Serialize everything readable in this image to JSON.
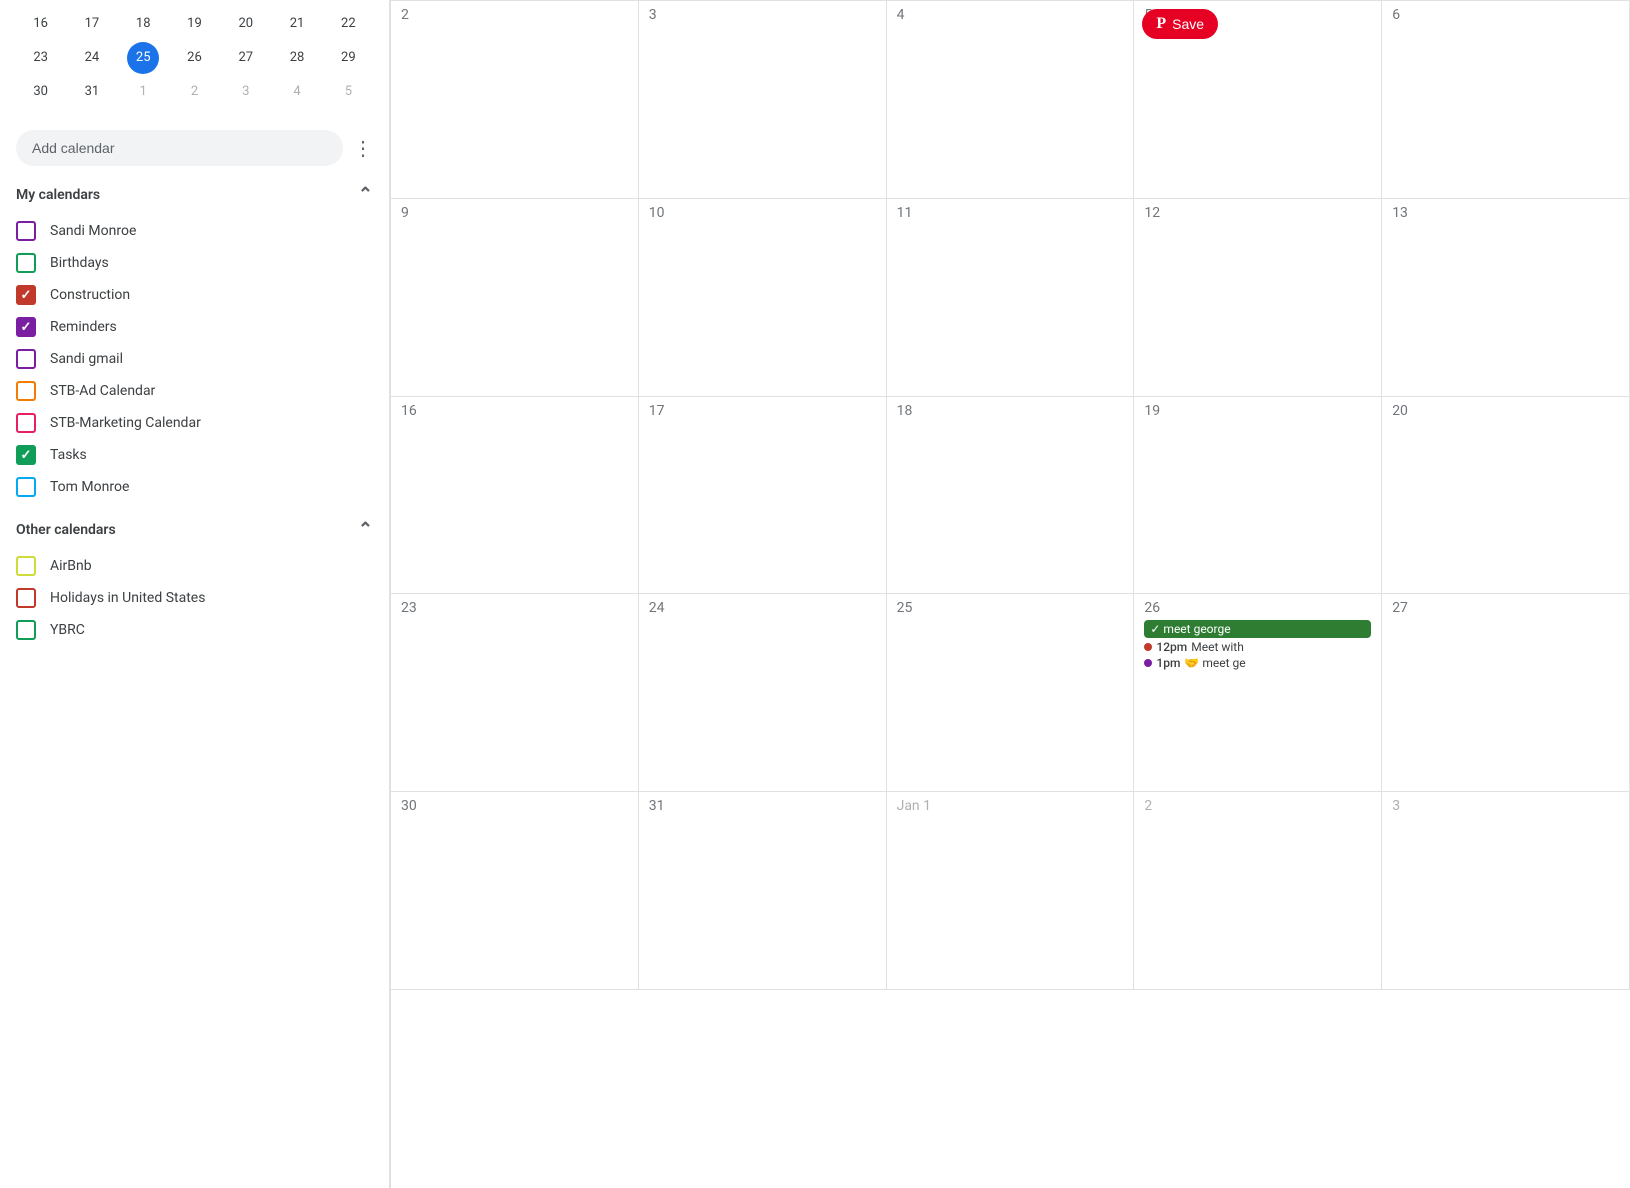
{
  "sidebar": {
    "miniCal": {
      "rows": [
        [
          "16",
          "17",
          "18",
          "19",
          "20",
          "21",
          "22"
        ],
        [
          "23",
          "24",
          "25",
          "26",
          "27",
          "28",
          "29"
        ],
        [
          "30",
          "31",
          "1",
          "2",
          "3",
          "4",
          "5"
        ]
      ],
      "todayDate": "25",
      "otherMonthDates": [
        "1",
        "2",
        "3",
        "4",
        "5"
      ]
    },
    "addCalendar": {
      "placeholder": "Add calendar",
      "moreIcon": "⋮"
    },
    "myCalendars": {
      "label": "My calendars",
      "collapseIcon": "^",
      "items": [
        {
          "id": "sandi-monroe",
          "label": "Sandi Monroe",
          "color": "#7b1fa2",
          "checked": false
        },
        {
          "id": "birthdays",
          "label": "Birthdays",
          "color": "#0f9d58",
          "checked": false
        },
        {
          "id": "construction",
          "label": "Construction",
          "color": "#c0392b",
          "checked": true
        },
        {
          "id": "reminders",
          "label": "Reminders",
          "color": "#7b1fa2",
          "checked": true
        },
        {
          "id": "sandi-gmail",
          "label": "Sandi gmail",
          "color": "#7b1fa2",
          "checked": false
        },
        {
          "id": "stb-ad",
          "label": "STB-Ad Calendar",
          "color": "#f57c00",
          "checked": false
        },
        {
          "id": "stb-marketing",
          "label": "STB-Marketing Calendar",
          "color": "#e91e63",
          "checked": false
        },
        {
          "id": "tasks",
          "label": "Tasks",
          "color": "#0f9d58",
          "checked": true
        },
        {
          "id": "tom-monroe",
          "label": "Tom Monroe",
          "color": "#03a9f4",
          "checked": false
        }
      ]
    },
    "otherCalendars": {
      "label": "Other calendars",
      "collapseIcon": "^",
      "items": [
        {
          "id": "airbnb",
          "label": "AirBnb",
          "color": "#cddc39",
          "checked": false
        },
        {
          "id": "holidays-us",
          "label": "Holidays in United States",
          "color": "#c0392b",
          "checked": false
        },
        {
          "id": "ybrc",
          "label": "YBRC",
          "color": "#0f9d58",
          "checked": false
        }
      ]
    }
  },
  "calendar": {
    "saveButton": {
      "label": "Save",
      "pinterestIcon": "𝗣"
    },
    "cells": [
      {
        "row": 0,
        "col": 0,
        "day": "2",
        "today": false,
        "otherMonth": false,
        "events": []
      },
      {
        "row": 0,
        "col": 1,
        "day": "3",
        "today": false,
        "otherMonth": false,
        "events": []
      },
      {
        "row": 0,
        "col": 2,
        "day": "4",
        "today": false,
        "otherMonth": false,
        "events": []
      },
      {
        "row": 0,
        "col": 3,
        "day": "5",
        "today": false,
        "otherMonth": false,
        "hasSaveBtn": true,
        "events": []
      },
      {
        "row": 0,
        "col": 4,
        "day": "6",
        "today": false,
        "otherMonth": false,
        "events": []
      },
      {
        "row": 1,
        "col": 0,
        "day": "9",
        "today": false,
        "otherMonth": false,
        "events": []
      },
      {
        "row": 1,
        "col": 1,
        "day": "10",
        "today": false,
        "otherMonth": false,
        "events": []
      },
      {
        "row": 1,
        "col": 2,
        "day": "11",
        "today": false,
        "otherMonth": false,
        "events": []
      },
      {
        "row": 1,
        "col": 3,
        "day": "12",
        "today": false,
        "otherMonth": false,
        "events": []
      },
      {
        "row": 1,
        "col": 4,
        "day": "13",
        "today": false,
        "otherMonth": false,
        "events": []
      },
      {
        "row": 2,
        "col": 0,
        "day": "16",
        "today": false,
        "otherMonth": false,
        "events": []
      },
      {
        "row": 2,
        "col": 1,
        "day": "17",
        "today": false,
        "otherMonth": false,
        "events": []
      },
      {
        "row": 2,
        "col": 2,
        "day": "18",
        "today": false,
        "otherMonth": false,
        "events": []
      },
      {
        "row": 2,
        "col": 3,
        "day": "19",
        "today": false,
        "otherMonth": false,
        "events": []
      },
      {
        "row": 2,
        "col": 4,
        "day": "20",
        "today": false,
        "otherMonth": false,
        "events": []
      },
      {
        "row": 3,
        "col": 0,
        "day": "23",
        "today": false,
        "otherMonth": false,
        "events": []
      },
      {
        "row": 3,
        "col": 1,
        "day": "24",
        "today": false,
        "otherMonth": false,
        "events": []
      },
      {
        "row": 3,
        "col": 2,
        "day": "25",
        "today": true,
        "otherMonth": false,
        "events": []
      },
      {
        "row": 3,
        "col": 3,
        "day": "26",
        "today": false,
        "otherMonth": false,
        "events": [
          {
            "type": "chip",
            "label": "✓ meet george",
            "bg": "#2e7d32",
            "textColor": "#fff"
          },
          {
            "type": "dot",
            "time": "12pm",
            "label": "Meet with",
            "dotColor": "#c0392b"
          },
          {
            "type": "dot",
            "time": "1pm",
            "label": "meet ge",
            "dotColor": "#7b1fa2",
            "icon": "🤝"
          }
        ]
      },
      {
        "row": 3,
        "col": 4,
        "day": "27",
        "today": false,
        "otherMonth": false,
        "events": []
      },
      {
        "row": 4,
        "col": 0,
        "day": "30",
        "today": false,
        "otherMonth": false,
        "events": []
      },
      {
        "row": 4,
        "col": 1,
        "day": "31",
        "today": false,
        "otherMonth": false,
        "events": []
      },
      {
        "row": 4,
        "col": 2,
        "day": "Jan 1",
        "today": false,
        "otherMonth": true,
        "events": []
      },
      {
        "row": 4,
        "col": 3,
        "day": "2",
        "today": false,
        "otherMonth": true,
        "events": []
      },
      {
        "row": 4,
        "col": 4,
        "day": "3",
        "today": false,
        "otherMonth": true,
        "events": []
      }
    ]
  }
}
